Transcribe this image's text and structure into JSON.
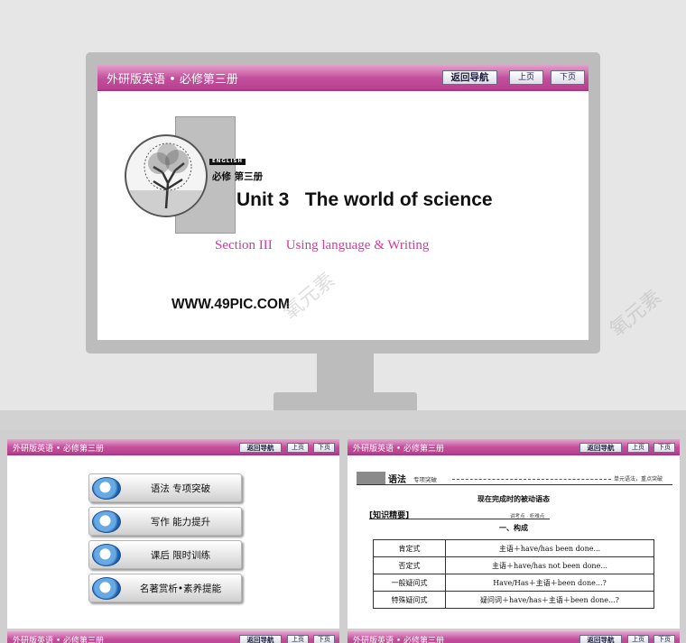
{
  "header": {
    "book_title": "外研版英语 • 必修第三册",
    "nav_button": "返回导航",
    "prev_button": "上页",
    "next_button": "下页"
  },
  "cover": {
    "english_tag": "ENGLISH",
    "series": "必修 第三册",
    "unit_title": "Unit 3   The world of science",
    "section_title": "Section III    Using language & Writing",
    "url": "WWW.49PIC.COM"
  },
  "menu": {
    "items": [
      {
        "label": "语法 专项突破"
      },
      {
        "label": "写作 能力提升"
      },
      {
        "label": "课后 限时训练"
      },
      {
        "label": "名著赏析•素养提能"
      }
    ]
  },
  "grammar": {
    "heading": "语法",
    "heading_sub": "专项突破",
    "heading_right": "单元语法，重点突破",
    "topic": "现在完成时的被动语态",
    "knowledge_label": "[知识精要]",
    "knowledge_sub": "讲考点 · 析难点",
    "section": "一、构成",
    "rows": [
      {
        "key": "肯定式",
        "value": "主语＋have/has been done..."
      },
      {
        "key": "否定式",
        "value": "主语＋have/has not been done..."
      },
      {
        "key": "一般疑问式",
        "value": "Have/Has＋主语＋been done...?"
      },
      {
        "key": "特殊疑问式",
        "value": "疑问词＋have/has＋主语＋been done...?"
      }
    ]
  },
  "watermark": "氧元素"
}
